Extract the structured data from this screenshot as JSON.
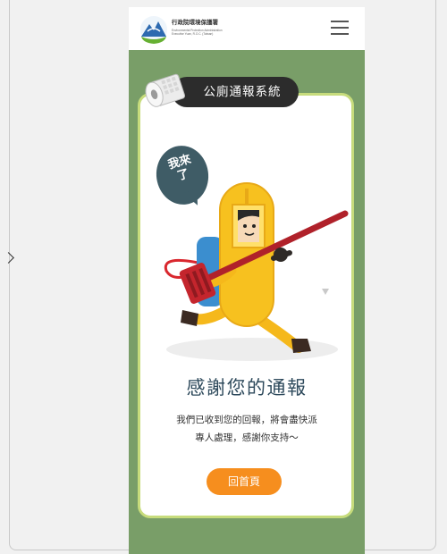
{
  "header": {
    "org_name": "行政院環境保護署",
    "org_eng": "Environmental Protection Administration Executive Yuan, R.O.C. (Taiwan)",
    "logo_icon": "epa-logo-icon",
    "menu_icon": "hamburger-menu-icon"
  },
  "banner": {
    "title": "公廁通報系統",
    "icon": "toilet-paper-icon"
  },
  "illustration": {
    "speech_bubble": "我來了",
    "character": "yellow-capsule-cleaner-running-with-hose"
  },
  "content": {
    "thanks_heading": "感謝您的通報",
    "message_line1": "我們已收到您的回報，將會盡快派",
    "message_line2": "專人處理，感謝你支持～",
    "home_button": "回首頁"
  },
  "colors": {
    "background_green": "#799e68",
    "card_border": "#c7dc7c",
    "pill_dark": "#2c2c2c",
    "accent_orange": "#f68e1e",
    "heading_blue": "#2e4a5c"
  }
}
